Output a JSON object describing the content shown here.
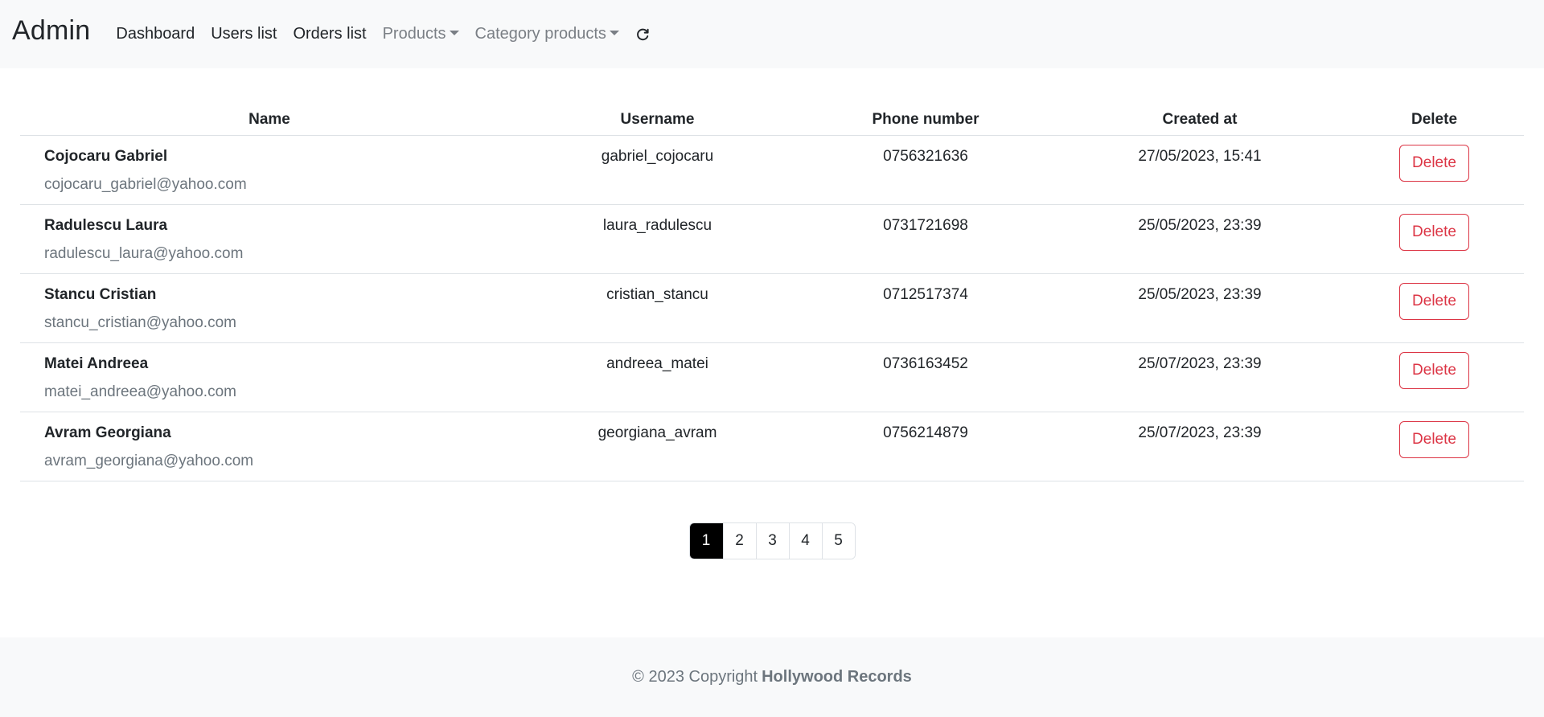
{
  "navbar": {
    "brand": "Admin",
    "links": [
      {
        "label": "Dashboard"
      },
      {
        "label": "Users list"
      },
      {
        "label": "Orders list"
      },
      {
        "label": "Products"
      },
      {
        "label": "Category products"
      }
    ],
    "refresh_icon": "refresh-icon"
  },
  "table": {
    "headers": [
      "Name",
      "Username",
      "Phone number",
      "Created at",
      "Delete"
    ],
    "rows": [
      {
        "name": "Cojocaru Gabriel",
        "email": "cojocaru_gabriel@yahoo.com",
        "username": "gabriel_cojocaru",
        "phone": "0756321636",
        "created": "27/05/2023, 15:41",
        "delete_label": "Delete"
      },
      {
        "name": "Radulescu Laura",
        "email": "radulescu_laura@yahoo.com",
        "username": "laura_radulescu",
        "phone": "0731721698",
        "created": "25/05/2023, 23:39",
        "delete_label": "Delete"
      },
      {
        "name": "Stancu Cristian",
        "email": "stancu_cristian@yahoo.com",
        "username": "cristian_stancu",
        "phone": "0712517374",
        "created": "25/05/2023, 23:39",
        "delete_label": "Delete"
      },
      {
        "name": "Matei Andreea",
        "email": "matei_andreea@yahoo.com",
        "username": "andreea_matei",
        "phone": "0736163452",
        "created": "25/07/2023, 23:39",
        "delete_label": "Delete"
      },
      {
        "name": "Avram Georgiana",
        "email": "avram_georgiana@yahoo.com",
        "username": "georgiana_avram",
        "phone": "0756214879",
        "created": "25/07/2023, 23:39",
        "delete_label": "Delete"
      }
    ]
  },
  "pagination": {
    "pages": [
      "1",
      "2",
      "3",
      "4",
      "5"
    ],
    "active": "1"
  },
  "footer": {
    "prefix": "© 2023 Copyright",
    "company": "Hollywood Records"
  },
  "colors": {
    "danger": "#dc3545",
    "navbar_bg": "#f8f9fa",
    "active_page": "#000000"
  }
}
